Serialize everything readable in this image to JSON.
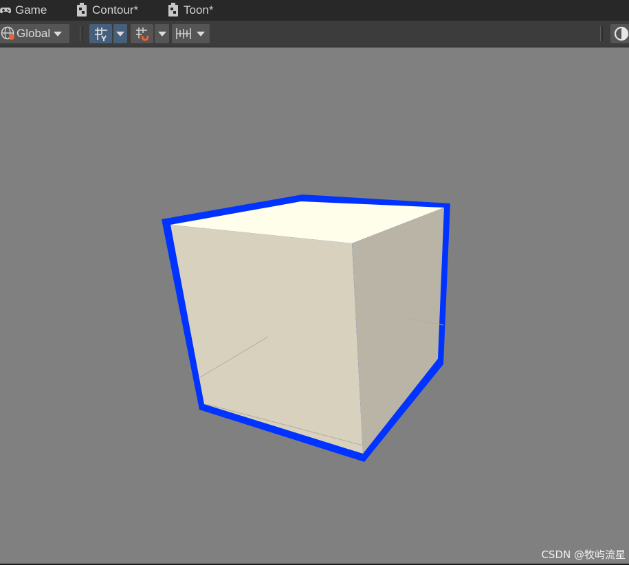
{
  "tabs": [
    {
      "label": "Game",
      "icon": "gamepad-icon"
    },
    {
      "label": "Contour*",
      "icon": "shader-graph-icon"
    },
    {
      "label": "Toon*",
      "icon": "shader-graph-icon"
    }
  ],
  "toolbar": {
    "pivot_rotation_label": "Global",
    "pivot_rotation_icon": "globe-icon",
    "grid_snap_icon": "grid-snap-icon",
    "increment_snap_icon": "increment-snap-icon",
    "snap_settings_icon": "ruler-icon",
    "draw_mode_icon": "shading-mode-icon"
  },
  "colors": {
    "selection_outline": "#0033ff",
    "viewport_background": "#808080",
    "cube_top": "#fffeea",
    "cube_front": "#d8d1be",
    "cube_side": "#b9b4a6"
  },
  "watermark": "CSDN @牧屿流星"
}
